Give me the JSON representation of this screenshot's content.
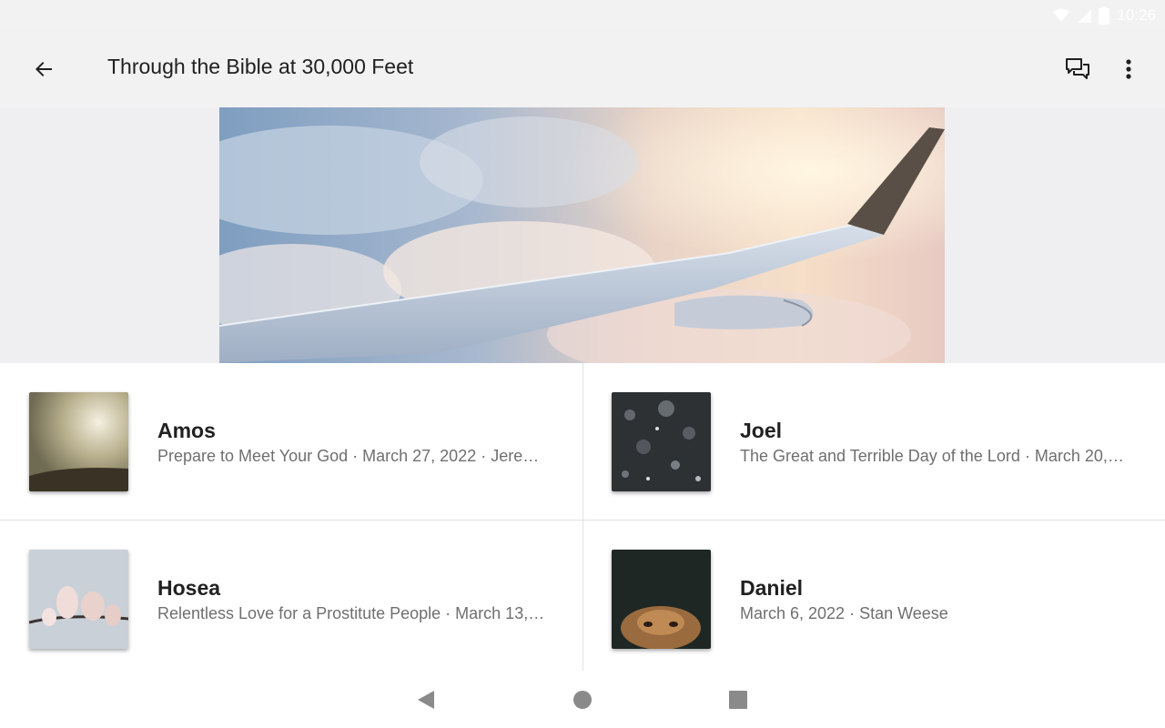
{
  "status_bar": {
    "time": "10:26",
    "icons": [
      "wifi-icon",
      "signal-icon",
      "battery-icon"
    ]
  },
  "app_bar": {
    "title": "Through the Bible at 30,000 Feet",
    "back_icon": "arrow-back-icon",
    "actions": [
      "chat-icon",
      "more-vert-icon"
    ]
  },
  "hero": {
    "image": "airplane-wing-above-clouds"
  },
  "sermons": [
    {
      "title": "Amos",
      "subtitle": "Prepare to Meet Your God · March 27, 2022 · Jere…",
      "thumbnail": "sunlit-clouds-over-hills"
    },
    {
      "title": "Joel",
      "subtitle": "The Great and Terrible Day of the Lord · March 20,…",
      "thumbnail": "falling-snow-dark-sky"
    },
    {
      "title": "Hosea",
      "subtitle": "Relentless Love for a Prostitute People · March 13,…",
      "thumbnail": "magnolia-blossoms"
    },
    {
      "title": "Daniel",
      "subtitle": "March 6, 2022 · Stan Weese",
      "thumbnail": "lion-face-dark-background"
    }
  ],
  "nav_bar": {
    "buttons": [
      "nav-back-icon",
      "nav-home-icon",
      "nav-recents-icon"
    ]
  },
  "colors": {
    "app_bar_bg": "#f2f2f2",
    "hero_band_bg": "#efeff1",
    "title_text": "#212121",
    "subtitle_text": "#6f6f6f",
    "divider": "#e3e3e3",
    "nav_icon": "#8a8a8a"
  }
}
